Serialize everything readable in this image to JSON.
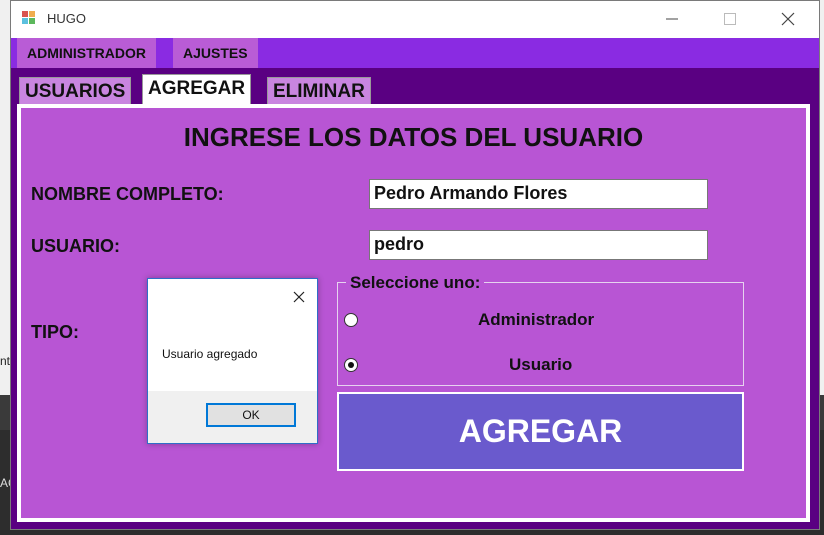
{
  "window": {
    "title": "HUGO"
  },
  "menu": {
    "items": [
      "ADMINISTRADOR",
      "AJUSTES"
    ]
  },
  "tabs": [
    "USUARIOS",
    "AGREGAR",
    "ELIMINAR"
  ],
  "form": {
    "heading": "INGRESE LOS DATOS DEL USUARIO",
    "nombre_label": "NOMBRE COMPLETO:",
    "nombre_value": "Pedro Armando Flores",
    "usuario_label": "USUARIO:",
    "usuario_value": "pedro",
    "tipo_label": "TIPO:",
    "group_title": "Seleccione uno:",
    "options": [
      {
        "label": "Administrador",
        "checked": false
      },
      {
        "label": "Usuario",
        "checked": true
      }
    ],
    "submit_label": "AGREGAR"
  },
  "dialog": {
    "message": "Usuario agregado",
    "ok_label": "OK"
  },
  "background": {
    "fragment1": "nt",
    "fragment2": "AC"
  },
  "colors": {
    "menubar": "#8a2be2",
    "panel": "#b855d4",
    "content_bg": "#5a0082",
    "button": "#6a5acd"
  }
}
